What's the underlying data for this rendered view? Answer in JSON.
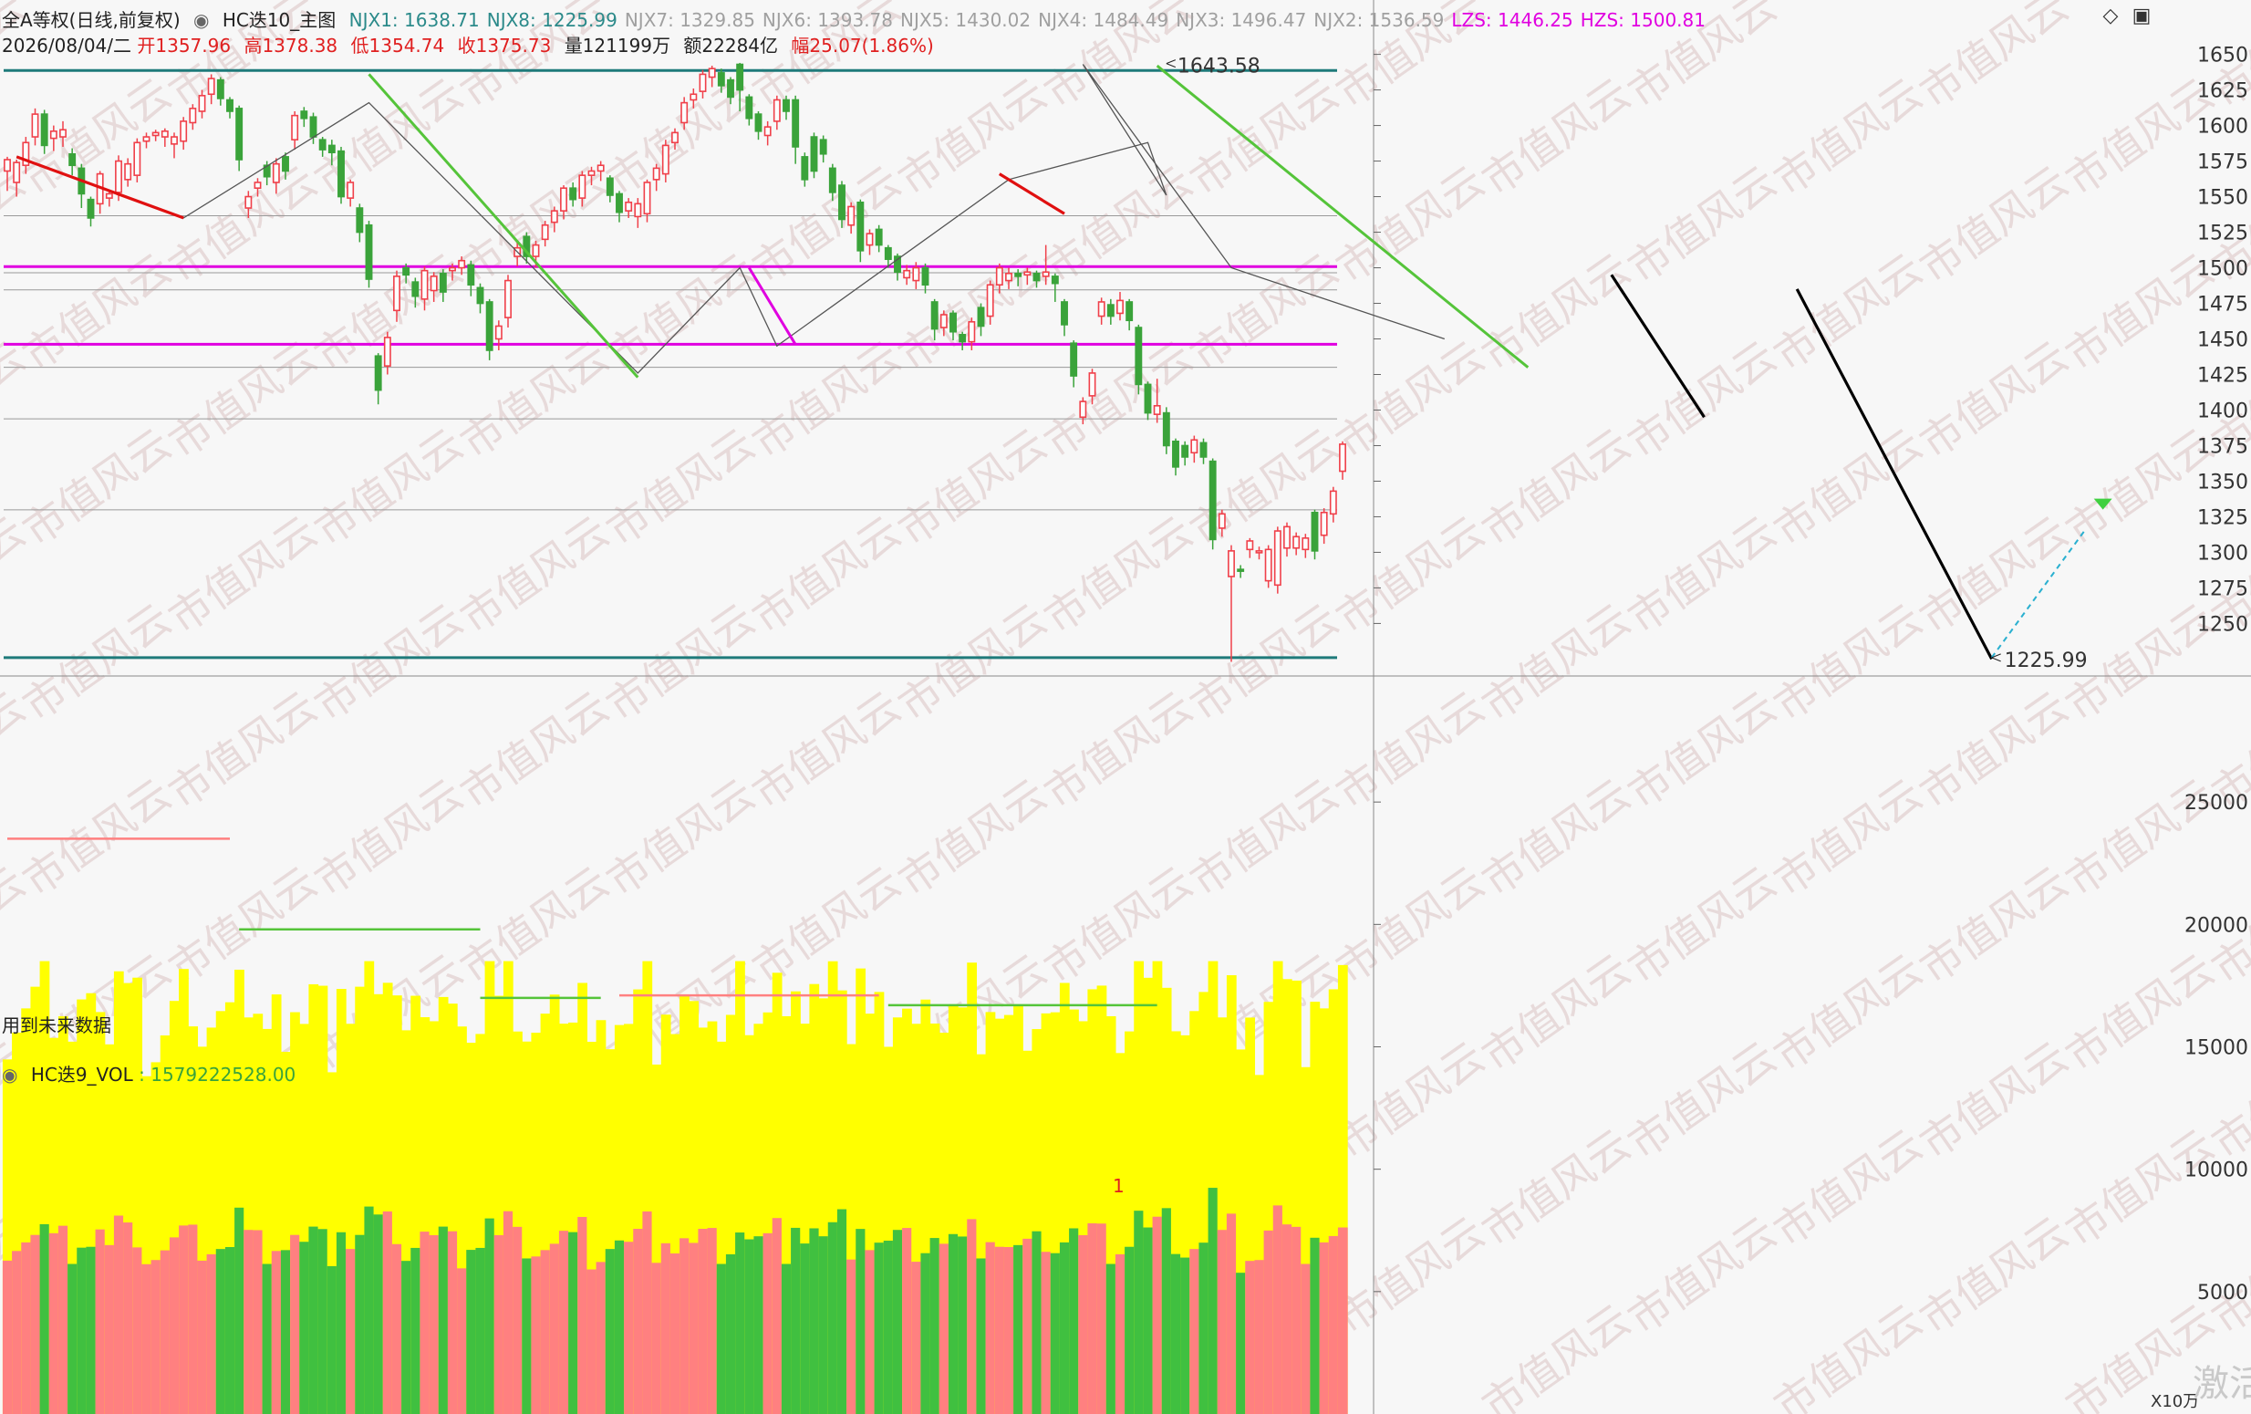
{
  "header": {
    "title": "全A等权(日线,前复权)",
    "indicator": "HC迭10_主图",
    "njx": [
      {
        "label": "NJX1: 1638.71",
        "color": "#2b8a8a"
      },
      {
        "label": "NJX8: 1225.99",
        "color": "#2b8a8a"
      },
      {
        "label": "NJX7: 1329.85",
        "color": "#a0a0a0"
      },
      {
        "label": "NJX6: 1393.78",
        "color": "#a0a0a0"
      },
      {
        "label": "NJX5: 1430.02",
        "color": "#a0a0a0"
      },
      {
        "label": "NJX4: 1484.49",
        "color": "#a0a0a0"
      },
      {
        "label": "NJX3: 1496.47",
        "color": "#a0a0a0"
      },
      {
        "label": "NJX2: 1536.59",
        "color": "#a0a0a0"
      },
      {
        "label": "LZS: 1446.25",
        "color": "#e000e0"
      },
      {
        "label": "HZS: 1500.81",
        "color": "#e000e0"
      }
    ],
    "date": "2026/08/04/二",
    "open": "开1357.96",
    "high": "高1378.38",
    "low": "低1354.74",
    "close": "收1375.73",
    "volume": "量121199万",
    "amount": "额22284亿",
    "change": "幅25.07(1.86%)"
  },
  "future_data_note": "用到未来数据",
  "vol_panel": {
    "title": "HC迭9_VOL",
    "value": ": 1579222528.00",
    "marker": "1",
    "unit": "X10万"
  },
  "watermark": "市值风云",
  "watermark_tail": "激活",
  "colors": {
    "up": "#f0404a",
    "down": "#3aa33a",
    "teal_line": "#1e7a7a",
    "magenta": "#e000e0",
    "green_wave": "#55c43a",
    "red_wave": "#e01010",
    "yellow": "#ffff00",
    "vol_green": "#40c040",
    "vol_red": "#ff8080"
  },
  "chart_data": [
    {
      "type": "candlestick",
      "ylim": [
        1215,
        1660
      ],
      "yticks": [
        1650,
        1625,
        1600,
        1575,
        1550,
        1525,
        1500,
        1475,
        1450,
        1425,
        1400,
        1375,
        1350,
        1325,
        1300,
        1275,
        1250
      ],
      "hlines": [
        {
          "value": 1638.71,
          "style": "teal"
        },
        {
          "value": 1536.59,
          "style": "gray"
        },
        {
          "value": 1500.81,
          "style": "magenta"
        },
        {
          "value": 1496.47,
          "style": "gray"
        },
        {
          "value": 1484.49,
          "style": "gray"
        },
        {
          "value": 1446.25,
          "style": "magenta"
        },
        {
          "value": 1430.02,
          "style": "gray"
        },
        {
          "value": 1393.78,
          "style": "gray"
        },
        {
          "value": 1329.85,
          "style": "gray"
        },
        {
          "value": 1225.99,
          "style": "teal"
        }
      ],
      "peak_label": "1643.58",
      "trough_label": "1225.99",
      "candles": [
        [
          1568,
          1576,
          1561,
          1578,
          1554
        ],
        [
          1560,
          1574,
          1556,
          1576,
          1550
        ],
        [
          1572,
          1588,
          1570,
          1592,
          1566
        ],
        [
          1592,
          1608,
          1589,
          1612,
          1586
        ],
        [
          1608,
          1586,
          1584,
          1611,
          1580
        ],
        [
          1591,
          1596,
          1587,
          1600,
          1582
        ],
        [
          1592,
          1597,
          1589,
          1603,
          1585
        ],
        [
          1580,
          1572,
          1570,
          1584,
          1565
        ],
        [
          1570,
          1552,
          1550,
          1573,
          1542
        ],
        [
          1548,
          1535,
          1532,
          1550,
          1529
        ],
        [
          1545,
          1566,
          1540,
          1568,
          1538
        ],
        [
          1549,
          1552,
          1546,
          1554,
          1543
        ],
        [
          1553,
          1575,
          1550,
          1579,
          1547
        ],
        [
          1562,
          1573,
          1560,
          1577,
          1557
        ],
        [
          1565,
          1588,
          1562,
          1591,
          1560
        ],
        [
          1589,
          1592,
          1587,
          1595,
          1584
        ],
        [
          1593,
          1595,
          1591,
          1597,
          1589
        ],
        [
          1592,
          1596,
          1589,
          1598,
          1585
        ],
        [
          1587,
          1592,
          1580,
          1595,
          1577
        ],
        [
          1589,
          1603,
          1586,
          1606,
          1583
        ],
        [
          1602,
          1612,
          1600,
          1615,
          1597
        ],
        [
          1610,
          1621,
          1608,
          1625,
          1605
        ],
        [
          1622,
          1633,
          1619,
          1636,
          1615
        ],
        [
          1632,
          1619,
          1618,
          1634,
          1614
        ],
        [
          1618,
          1610,
          1608,
          1620,
          1605
        ],
        [
          1612,
          1576,
          1572,
          1614,
          1568
        ],
        [
          1542,
          1550,
          1538,
          1554,
          1535
        ],
        [
          1556,
          1560,
          1553,
          1563,
          1550
        ],
        [
          1572,
          1564,
          1561,
          1575,
          1558
        ],
        [
          1560,
          1573,
          1557,
          1577,
          1552
        ],
        [
          1578,
          1568,
          1566,
          1581,
          1562
        ],
        [
          1590,
          1607,
          1587,
          1610,
          1583
        ],
        [
          1610,
          1605,
          1602,
          1613,
          1599
        ],
        [
          1606,
          1592,
          1590,
          1609,
          1587
        ],
        [
          1590,
          1583,
          1581,
          1592,
          1578
        ],
        [
          1586,
          1581,
          1578,
          1590,
          1572
        ],
        [
          1582,
          1550,
          1548,
          1585,
          1545
        ],
        [
          1549,
          1560,
          1546,
          1562,
          1543
        ],
        [
          1542,
          1525,
          1522,
          1545,
          1518
        ],
        [
          1530,
          1492,
          1490,
          1533,
          1486
        ],
        [
          1438,
          1414,
          1410,
          1440,
          1404
        ],
        [
          1431,
          1451,
          1428,
          1455,
          1425
        ],
        [
          1470,
          1494,
          1466,
          1498,
          1462
        ],
        [
          1500,
          1495,
          1492,
          1503,
          1489
        ],
        [
          1490,
          1480,
          1476,
          1493,
          1472
        ],
        [
          1478,
          1498,
          1475,
          1501,
          1470
        ],
        [
          1484,
          1494,
          1480,
          1497,
          1476
        ],
        [
          1496,
          1483,
          1480,
          1499,
          1476
        ],
        [
          1498,
          1500,
          1494,
          1503,
          1491
        ],
        [
          1500,
          1505,
          1498,
          1508,
          1495
        ],
        [
          1502,
          1488,
          1484,
          1505,
          1480
        ],
        [
          1486,
          1475,
          1472,
          1489,
          1468
        ],
        [
          1476,
          1442,
          1440,
          1478,
          1435
        ],
        [
          1450,
          1459,
          1446,
          1463,
          1442
        ],
        [
          1465,
          1491,
          1462,
          1495,
          1458
        ],
        [
          1508,
          1514,
          1505,
          1518,
          1501
        ],
        [
          1522,
          1508,
          1506,
          1525,
          1503
        ],
        [
          1508,
          1516,
          1504,
          1519,
          1500
        ],
        [
          1520,
          1530,
          1518,
          1533,
          1515
        ],
        [
          1532,
          1540,
          1528,
          1543,
          1525
        ],
        [
          1540,
          1556,
          1537,
          1558,
          1534
        ],
        [
          1556,
          1548,
          1546,
          1560,
          1543
        ],
        [
          1549,
          1565,
          1546,
          1568,
          1543
        ],
        [
          1565,
          1568,
          1562,
          1571,
          1558
        ],
        [
          1568,
          1572,
          1565,
          1575,
          1561
        ],
        [
          1563,
          1551,
          1549,
          1565,
          1546
        ],
        [
          1552,
          1539,
          1536,
          1554,
          1532
        ],
        [
          1540,
          1546,
          1538,
          1549,
          1535
        ],
        [
          1536,
          1545,
          1532,
          1549,
          1528
        ],
        [
          1538,
          1560,
          1535,
          1562,
          1532
        ],
        [
          1562,
          1570,
          1558,
          1573,
          1554
        ],
        [
          1566,
          1586,
          1563,
          1590,
          1560
        ],
        [
          1588,
          1595,
          1586,
          1598,
          1583
        ],
        [
          1602,
          1616,
          1600,
          1620,
          1597
        ],
        [
          1618,
          1622,
          1616,
          1626,
          1612
        ],
        [
          1624,
          1636,
          1622,
          1639,
          1619
        ],
        [
          1634,
          1640,
          1630,
          1642,
          1627
        ],
        [
          1637,
          1628,
          1626,
          1640,
          1623
        ],
        [
          1632,
          1620,
          1617,
          1634,
          1615
        ],
        [
          1643,
          1625,
          1613,
          1644,
          1610
        ],
        [
          1620,
          1605,
          1603,
          1622,
          1600
        ],
        [
          1608,
          1596,
          1594,
          1610,
          1590
        ],
        [
          1593,
          1599,
          1590,
          1603,
          1586
        ],
        [
          1603,
          1618,
          1600,
          1621,
          1597
        ],
        [
          1618,
          1610,
          1607,
          1621,
          1604
        ],
        [
          1618,
          1585,
          1580,
          1621,
          1573
        ],
        [
          1578,
          1562,
          1560,
          1581,
          1557
        ],
        [
          1592,
          1568,
          1566,
          1595,
          1563
        ],
        [
          1590,
          1580,
          1577,
          1593,
          1574
        ],
        [
          1570,
          1553,
          1550,
          1573,
          1547
        ],
        [
          1558,
          1534,
          1532,
          1561,
          1528
        ],
        [
          1530,
          1543,
          1528,
          1546,
          1524
        ],
        [
          1546,
          1512,
          1508,
          1548,
          1504
        ],
        [
          1516,
          1524,
          1512,
          1527,
          1509
        ],
        [
          1527,
          1516,
          1514,
          1530,
          1511
        ],
        [
          1514,
          1506,
          1504,
          1516,
          1500
        ],
        [
          1508,
          1497,
          1494,
          1510,
          1491
        ],
        [
          1493,
          1498,
          1490,
          1502,
          1488
        ],
        [
          1491,
          1500,
          1488,
          1504,
          1485
        ],
        [
          1500,
          1488,
          1485,
          1503,
          1482
        ],
        [
          1476,
          1457,
          1452,
          1478,
          1449
        ],
        [
          1458,
          1467,
          1455,
          1470,
          1452
        ],
        [
          1468,
          1455,
          1452,
          1470,
          1449
        ],
        [
          1453,
          1448,
          1445,
          1455,
          1442
        ],
        [
          1448,
          1462,
          1445,
          1465,
          1442
        ],
        [
          1472,
          1459,
          1456,
          1475,
          1452
        ],
        [
          1466,
          1488,
          1463,
          1491,
          1460
        ],
        [
          1488,
          1500,
          1485,
          1503,
          1482
        ],
        [
          1491,
          1496,
          1488,
          1500,
          1485
        ],
        [
          1496,
          1494,
          1491,
          1499,
          1487
        ],
        [
          1495,
          1497,
          1492,
          1500,
          1488
        ],
        [
          1496,
          1491,
          1489,
          1498,
          1486
        ],
        [
          1494,
          1497,
          1491,
          1516,
          1488
        ],
        [
          1494,
          1489,
          1478,
          1496,
          1476
        ],
        [
          1476,
          1460,
          1456,
          1478,
          1452
        ],
        [
          1447,
          1424,
          1420,
          1449,
          1416
        ],
        [
          1395,
          1406,
          1392,
          1409,
          1390
        ],
        [
          1410,
          1426,
          1407,
          1429,
          1404
        ],
        [
          1466,
          1476,
          1463,
          1479,
          1460
        ],
        [
          1474,
          1466,
          1464,
          1478,
          1460
        ],
        [
          1468,
          1477,
          1466,
          1483,
          1463
        ],
        [
          1476,
          1463,
          1460,
          1478,
          1456
        ],
        [
          1458,
          1418,
          1415,
          1460,
          1411
        ],
        [
          1418,
          1398,
          1396,
          1420,
          1393
        ],
        [
          1397,
          1403,
          1394,
          1422,
          1391
        ],
        [
          1398,
          1375,
          1372,
          1402,
          1369
        ],
        [
          1378,
          1360,
          1357,
          1380,
          1354
        ],
        [
          1375,
          1367,
          1364,
          1378,
          1361
        ],
        [
          1370,
          1379,
          1366,
          1382,
          1363
        ],
        [
          1377,
          1367,
          1364,
          1380,
          1362
        ],
        [
          1364,
          1309,
          1306,
          1366,
          1302
        ],
        [
          1317,
          1327,
          1314,
          1330,
          1311
        ],
        [
          1283,
          1301,
          1280,
          1305,
          1223
        ],
        [
          1288,
          1287,
          1285,
          1291,
          1282
        ],
        [
          1302,
          1308,
          1299,
          1310,
          1296
        ],
        [
          1301,
          1301,
          1298,
          1304,
          1295
        ],
        [
          1280,
          1302,
          1278,
          1305,
          1275
        ],
        [
          1277,
          1315,
          1274,
          1318,
          1271
        ],
        [
          1303,
          1318,
          1300,
          1321,
          1297
        ],
        [
          1303,
          1311,
          1301,
          1314,
          1298
        ],
        [
          1302,
          1310,
          1299,
          1313,
          1296
        ],
        [
          1328,
          1301,
          1298,
          1330,
          1295
        ],
        [
          1312,
          1328,
          1309,
          1331,
          1306
        ],
        [
          1327,
          1343,
          1324,
          1346,
          1321
        ],
        [
          1357,
          1376,
          1354,
          1378,
          1351
        ]
      ]
    },
    {
      "type": "area",
      "ylim": [
        0,
        30000
      ],
      "yticks": [
        25000,
        20000,
        15000,
        10000,
        5000
      ],
      "unit": "X10万",
      "signal_lines": [
        {
          "color": "#ff8080",
          "level": 23500,
          "from": 0,
          "to": 24
        },
        {
          "color": "#55c43a",
          "level": 19800,
          "from": 25,
          "to": 51
        },
        {
          "color": "#55c43a",
          "level": 17000,
          "from": 51,
          "to": 64
        },
        {
          "color": "#ff8080",
          "level": 17100,
          "from": 66,
          "to": 94
        },
        {
          "color": "#55c43a",
          "level": 16700,
          "from": 95,
          "to": 124
        }
      ]
    }
  ]
}
